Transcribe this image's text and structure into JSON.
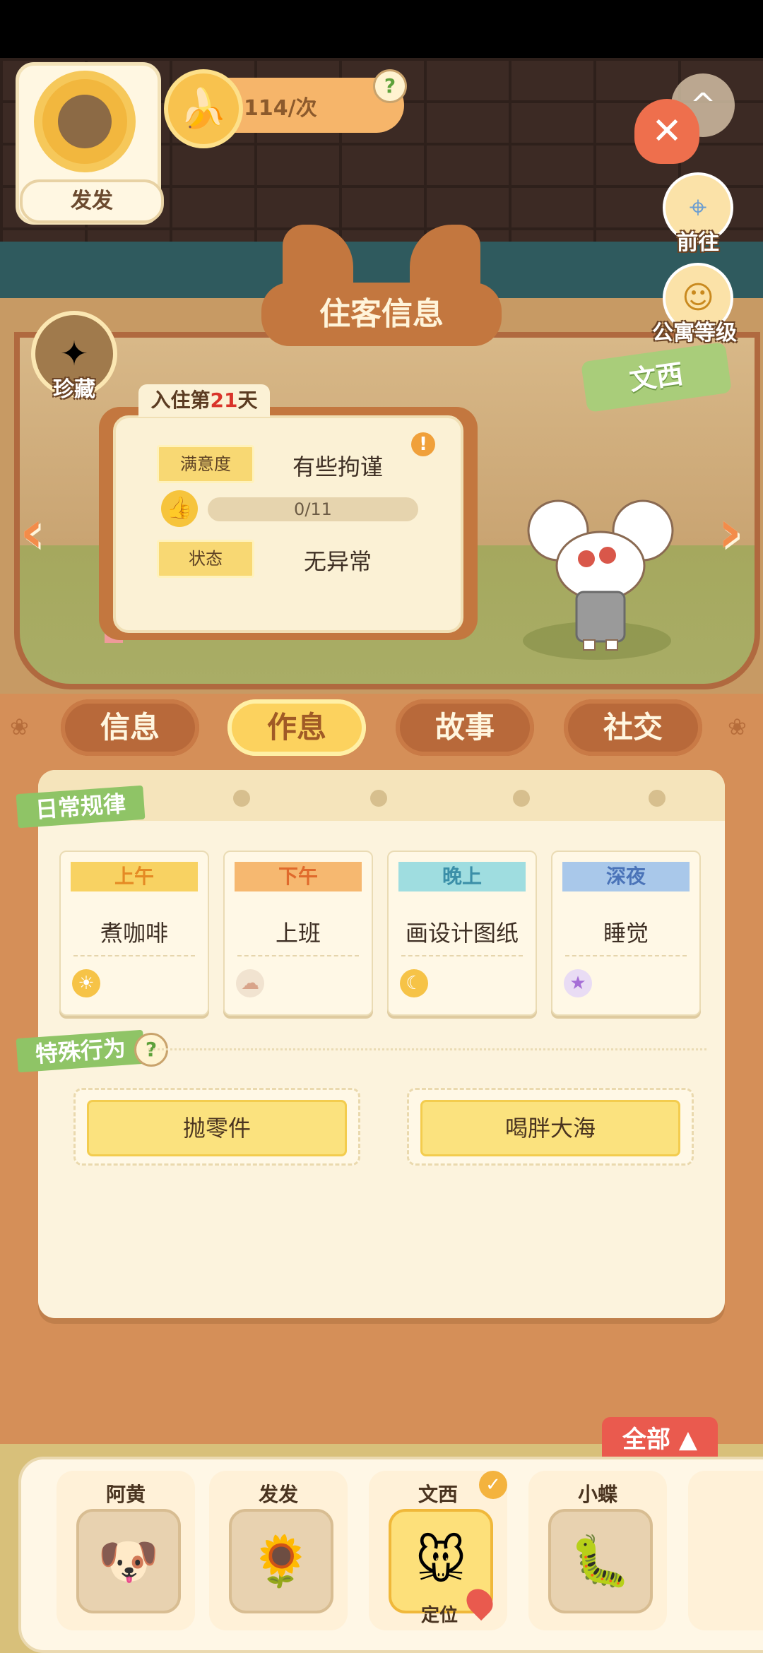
{
  "player": {
    "name": "发发",
    "avatar_icon": "sunflower-icon"
  },
  "currency": {
    "value": "114/次",
    "icon": "banana-icon",
    "help": "?"
  },
  "side_buttons": {
    "goto": "前往",
    "level": "公寓等级",
    "treasure": "珍藏"
  },
  "panel": {
    "title": "住客信息",
    "resident_name": "文西",
    "days_prefix": "入住第",
    "days_num": "21",
    "days_suffix": "天",
    "satisfaction_label": "满意度",
    "satisfaction_value": "有些拘谨",
    "warning": "!",
    "likes": "0/11",
    "status_label": "状态",
    "status_value": "无异常"
  },
  "tabs": [
    "信息",
    "作息",
    "故事",
    "社交"
  ],
  "active_tab": "作息",
  "routine": {
    "section": "日常规律",
    "slots": [
      {
        "time": "上午",
        "activity": "煮咖啡",
        "color": "#f8d262",
        "icon": "sun-icon"
      },
      {
        "time": "下午",
        "activity": "上班",
        "color": "#f6b870",
        "icon": "cloud-icon"
      },
      {
        "time": "晚上",
        "activity": "画设计图纸",
        "color": "#9fdde0",
        "icon": "moon-icon"
      },
      {
        "time": "深夜",
        "activity": "睡觉",
        "color": "#a9c8ea",
        "icon": "star-icon"
      }
    ]
  },
  "special": {
    "section": "特殊行为",
    "help": "?",
    "behaviors": [
      "抛零件",
      "喝胖大海"
    ]
  },
  "roster": {
    "all_label": "全部",
    "locate_label": "定位",
    "residents": [
      {
        "name": "阿黄",
        "icon": "dog-icon"
      },
      {
        "name": "发发",
        "icon": "sunflower-icon"
      },
      {
        "name": "文西",
        "icon": "mouse-icon"
      },
      {
        "name": "小蝶",
        "icon": "bug-icon"
      }
    ]
  }
}
